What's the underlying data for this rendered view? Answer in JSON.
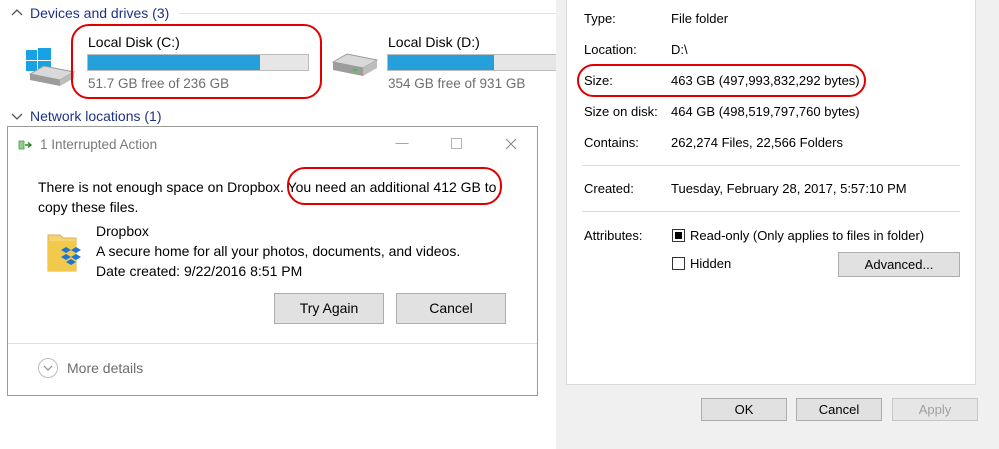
{
  "explorer": {
    "devices_header": "Devices and drives (3)",
    "network_header": "Network locations (1)",
    "drives": [
      {
        "name": "Local Disk (C:)",
        "free_text": "51.7 GB free of 236 GB",
        "used_fraction": 0.78
      },
      {
        "name": "Local Disk (D:)",
        "free_text": "354 GB free of 931 GB",
        "used_fraction": 0.62
      }
    ]
  },
  "dialog": {
    "title": "1 Interrupted Action",
    "message_part1": "There is not enough space on Dropbox. ",
    "message_highlight": "You need an additional 412 GB to",
    "message_part2": "copy these files.",
    "item_name": "Dropbox",
    "item_description": "A secure home for all your photos, documents, and videos.",
    "item_date": "Date created: 9/22/2016 8:51 PM",
    "try_again": "Try Again",
    "cancel": "Cancel",
    "more_details": "More details"
  },
  "properties": {
    "type_label": "Type:",
    "type_value": "File folder",
    "location_label": "Location:",
    "location_value": "D:\\",
    "size_label": "Size:",
    "size_value": "463 GB (497,993,832,292 bytes)",
    "size_on_disk_label": "Size on disk:",
    "size_on_disk_value": "464 GB (498,519,797,760 bytes)",
    "contains_label": "Contains:",
    "contains_value": "262,274 Files, 22,566 Folders",
    "created_label": "Created:",
    "created_value": "Tuesday, February 28, 2017, 5:57:10 PM",
    "attributes_label": "Attributes:",
    "readonly_label": "Read-only (Only applies to files in folder)",
    "readonly_checked": true,
    "hidden_label": "Hidden",
    "hidden_checked": false,
    "advanced_label": "Advanced...",
    "ok_label": "OK",
    "cancel_label": "Cancel",
    "apply_label": "Apply"
  },
  "colors": {
    "accent_bar": "#26a0da",
    "highlight_ring": "#e00000",
    "section_header": "#1e3287"
  }
}
